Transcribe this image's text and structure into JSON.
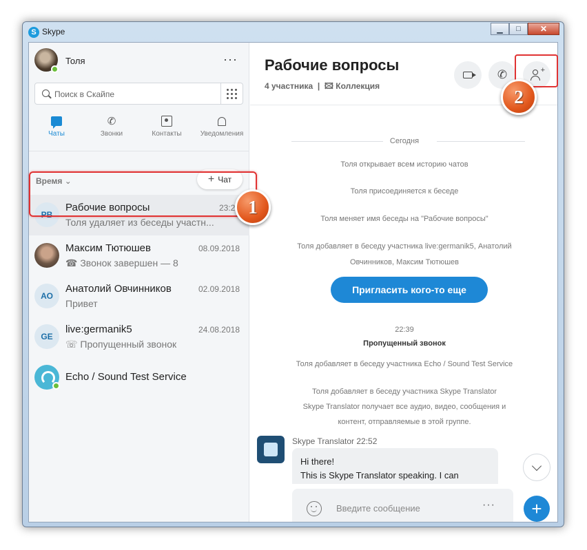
{
  "window": {
    "title": "Skype",
    "close_glyph": "✕",
    "minimize_glyph": "▁",
    "maximize_glyph": "□"
  },
  "profile": {
    "name": "Толя",
    "more": "···"
  },
  "search": {
    "placeholder": "Поиск в Скайпе"
  },
  "tabs": [
    {
      "label": "Чаты",
      "icon": "chat-icon",
      "active": true
    },
    {
      "label": "Звонки",
      "icon": "phone-icon"
    },
    {
      "label": "Контакты",
      "icon": "contacts-icon"
    },
    {
      "label": "Уведомления",
      "icon": "bell-icon"
    }
  ],
  "list_header": {
    "sort_label": "Время",
    "new_chat_label": "Чат"
  },
  "chats": [
    {
      "initials": "РВ",
      "name": "Рабочие вопросы",
      "date": "23:22",
      "preview": "Толя удаляет из беседы участн..."
    },
    {
      "initials": "",
      "name": "Максим Тютюшев",
      "date": "08.09.2018",
      "preview": "☎ Звонок завершен — 8"
    },
    {
      "initials": "АО",
      "name": "Анатолий Овчинников",
      "date": "02.09.2018",
      "preview": "Привет"
    },
    {
      "initials": "GE",
      "name": "live:germanik5",
      "date": "24.08.2018",
      "preview": "☏ Пропущенный звонок"
    },
    {
      "initials": "",
      "name": "Echo / Sound Test Service",
      "date": "",
      "preview": ""
    }
  ],
  "conversation": {
    "title": "Рабочие вопросы",
    "participants": "4 участника",
    "separator": "|",
    "gallery": "🖾 Коллекция",
    "day": "Сегодня",
    "events": [
      "Толя открывает всем историю чатов",
      "Толя присоединяется к беседе",
      "Толя меняет имя беседы на \"Рабочие вопросы\"",
      "Толя добавляет в беседу участника live:germanik5, Анатолий",
      "Овчинников, Максим Тютюшев"
    ],
    "invite_button": "Пригласить кого-то еще",
    "time2": "22:39",
    "missed_call": "Пропущенный звонок",
    "events2": [
      "Толя добавляет в беседу участника Echo / Sound Test Service",
      "Толя добавляет в беседу участника Skype Translator",
      "Skype Translator получает все аудио, видео, сообщения и",
      "контент, отправляемые в этой группе."
    ],
    "message": {
      "sender": "Skype Translator 22:52",
      "line1": "Hi there!",
      "line2": "This is Skype Translator speaking. I can"
    },
    "composer_placeholder": "Введите сообщение",
    "composer_more": "···",
    "add_glyph": "+"
  },
  "annotations": {
    "badge1": "1",
    "badge2": "2"
  },
  "colors": {
    "accent": "#1e88d6",
    "highlight": "#e03232",
    "badge": "#e2581d",
    "online": "#6bbf3b"
  }
}
